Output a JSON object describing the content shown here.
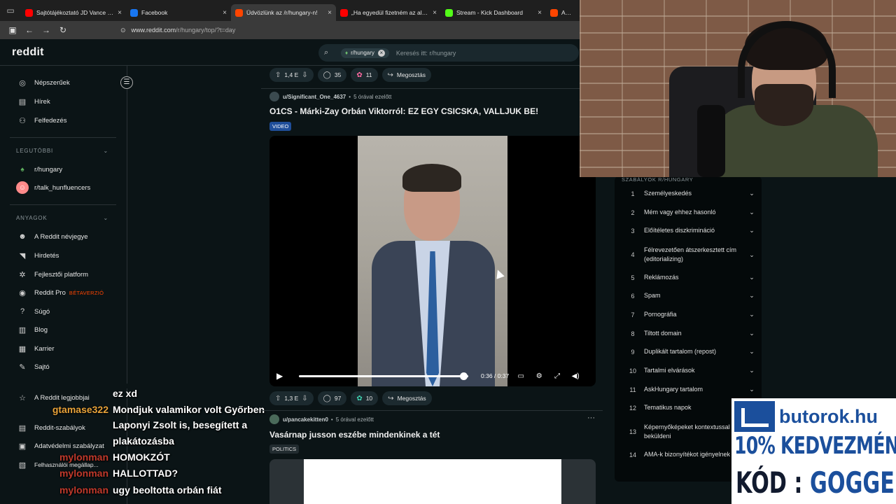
{
  "browser": {
    "tabs": [
      {
        "title": "Sajtótájékoztató JD Vance amerikai",
        "favicon_color": "#ff0000",
        "active": false
      },
      {
        "title": "Facebook",
        "favicon_color": "#1877f2",
        "active": false
      },
      {
        "title": "Üdvözlünk az /r/hungary-n!",
        "favicon_color": "#ff4500",
        "active": true
      },
      {
        "title": "„Ha egyedül fizetném az albérlet",
        "favicon_color": "#ff0000",
        "active": false
      },
      {
        "title": "Stream - Kick Dashboard",
        "favicon_color": "#53fc18",
        "active": false
      },
      {
        "title": "Amit a",
        "favicon_color": "#ff4500",
        "active": false
      }
    ],
    "close_glyph": "×",
    "url_host": "www.reddit.com",
    "url_path": "/r/hungary/top/?t=day"
  },
  "header": {
    "logo": "reddit",
    "search_chip": "r/hungary",
    "search_placeholder": "Keresés itt: r/hungary"
  },
  "sidebar": {
    "top_items": [
      {
        "label": "Népszerűek",
        "icon": "popular-icon"
      },
      {
        "label": "Hírek",
        "icon": "news-icon"
      },
      {
        "label": "Felfedezés",
        "icon": "explore-icon"
      }
    ],
    "recent_title": "LEGUTÓBBI",
    "recent_items": [
      {
        "label": "r/hungary",
        "icon": "subreddit-avatar"
      },
      {
        "label": "r/talk_hunfluencers",
        "icon": "subreddit-avatar"
      }
    ],
    "resources_title": "ANYAGOK",
    "resource_items": [
      {
        "label": "A Reddit névjegye",
        "icon": "reddit-icon"
      },
      {
        "label": "Hirdetés",
        "icon": "megaphone-icon"
      },
      {
        "label": "Fejlesztői platform",
        "icon": "dev-icon"
      },
      {
        "label": "Reddit Pro",
        "icon": "pro-icon",
        "badge": "BÉTAVERZIÓ"
      },
      {
        "label": "Súgó",
        "icon": "help-icon"
      },
      {
        "label": "Blog",
        "icon": "blog-icon"
      },
      {
        "label": "Karrier",
        "icon": "career-icon"
      },
      {
        "label": "Sajtó",
        "icon": "press-icon"
      }
    ],
    "bottom_items": [
      {
        "label": "A Reddit legjobbjai",
        "icon": "best-icon"
      },
      {
        "label": "Reddit-szabályok",
        "icon": "rules-icon"
      },
      {
        "label": "Adatvédelmi szabályzat",
        "icon": "privacy-icon"
      },
      {
        "label": "Felhasználói megállap...",
        "icon": "agreement-icon"
      }
    ]
  },
  "feed": {
    "post1_actions": {
      "votes": "1,4 E",
      "comments": "35",
      "awards": "11",
      "share": "Megosztás"
    },
    "post2": {
      "author": "u/Significant_One_4637",
      "time": "5 órával ezelőtt",
      "title": "O1CS - Márki-Zay Orbán Viktorról: EZ EGY CSICSKA, VALLJUK BE!",
      "flair": "VIDEO",
      "video_time": "0:36 / 0:37",
      "video_progress": 0.97,
      "actions": {
        "votes": "1,3 E",
        "comments": "97",
        "awards": "10",
        "share": "Megosztás"
      }
    },
    "post3": {
      "author": "u/pancakekitten0",
      "time": "5 órával ezelőtt",
      "title": "Vasárnap jusson eszébe mindenkinek a tét",
      "flair": "POLITICS"
    }
  },
  "rules": {
    "title": "SZABÁLYOK R/HUNGARY",
    "items": [
      {
        "num": "1",
        "text": "Személyeskedés"
      },
      {
        "num": "2",
        "text": "Mém vagy ehhez hasonló"
      },
      {
        "num": "3",
        "text": "Előítéletes diszkrimináció"
      },
      {
        "num": "4",
        "text": "Félrevezetően átszerkesztett cím (editorializing)"
      },
      {
        "num": "5",
        "text": "Reklámozás"
      },
      {
        "num": "6",
        "text": "Spam"
      },
      {
        "num": "7",
        "text": "Pornográfia"
      },
      {
        "num": "8",
        "text": "Tiltott domain"
      },
      {
        "num": "9",
        "text": "Duplikált tartalom (repost)"
      },
      {
        "num": "10",
        "text": "Tartalmi elvárások"
      },
      {
        "num": "11",
        "text": "AskHungary tartalom"
      },
      {
        "num": "12",
        "text": "Tematikus napok"
      },
      {
        "num": "13",
        "text": "Képernyőképeket kontextussal kérünk beküldeni"
      },
      {
        "num": "14",
        "text": "AMA-k bizonyítékot igényelnek"
      }
    ]
  },
  "chat": [
    {
      "user": "",
      "msg": "ez xd",
      "color": "#ffffff"
    },
    {
      "user": "gtamase322",
      "msg": "Mondjuk valamikor volt Győrben",
      "color": "#e8a33a"
    },
    {
      "user": "",
      "msg": "Laponyi Zsolt is, besegített a",
      "color": "#ffffff"
    },
    {
      "user": "",
      "msg": "plakátozásba",
      "color": "#ffffff"
    },
    {
      "user": "mylonman",
      "msg": "HOMOKZÓT",
      "color": "#c0392b"
    },
    {
      "user": "mylonman",
      "msg": "HALLOTTAD?",
      "color": "#c0392b"
    },
    {
      "user": "mylonman",
      "msg": "ugy beoltotta orbán fiát",
      "color": "#c0392b"
    }
  ],
  "ad": {
    "brand": "butorok.hu",
    "line1": "10% KEDVEZMÉNY",
    "line2_prefix": "KÓD : ",
    "line2_code": "GOGGER"
  }
}
